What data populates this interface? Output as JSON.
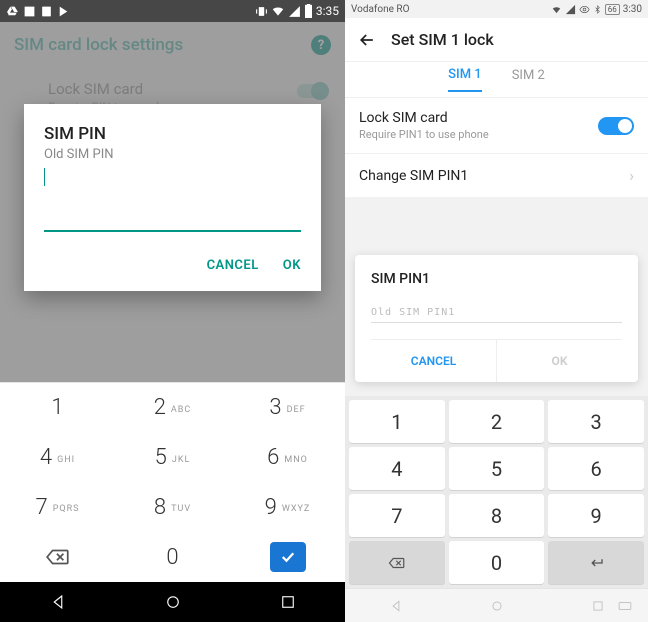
{
  "left": {
    "status": {
      "time": "3:35"
    },
    "header": {
      "title": "SIM card lock settings"
    },
    "setting": {
      "title": "Lock SIM card",
      "subtitle": "Require PIN to use phone"
    },
    "dialog": {
      "title": "SIM PIN",
      "subtitle": "Old SIM PIN",
      "cancel": "CANCEL",
      "ok": "OK"
    },
    "keypad": {
      "k1": "1",
      "k2": "2",
      "k2l": "ABC",
      "k3": "3",
      "k3l": "DEF",
      "k4": "4",
      "k4l": "GHI",
      "k5": "5",
      "k5l": "JKL",
      "k6": "6",
      "k6l": "MNO",
      "k7": "7",
      "k7l": "PQRS",
      "k8": "8",
      "k8l": "TUV",
      "k9": "9",
      "k9l": "WXYZ",
      "k0": "0"
    }
  },
  "right": {
    "status": {
      "carrier": "Vodafone RO",
      "battery": "66",
      "time": "3:30"
    },
    "header": {
      "title": "Set SIM 1 lock"
    },
    "tabs": {
      "sim1": "SIM 1",
      "sim2": "SIM 2"
    },
    "rows": {
      "lock_title": "Lock SIM card",
      "lock_sub": "Require PIN1 to use phone",
      "change": "Change SIM PIN1"
    },
    "dialog": {
      "title": "SIM PIN1",
      "placeholder": "Old SIM PIN1",
      "cancel": "CANCEL",
      "ok": "OK"
    },
    "keypad": {
      "k1": "1",
      "k2": "2",
      "k3": "3",
      "k4": "4",
      "k5": "5",
      "k6": "6",
      "k7": "7",
      "k8": "8",
      "k9": "9",
      "k0": "0"
    }
  }
}
